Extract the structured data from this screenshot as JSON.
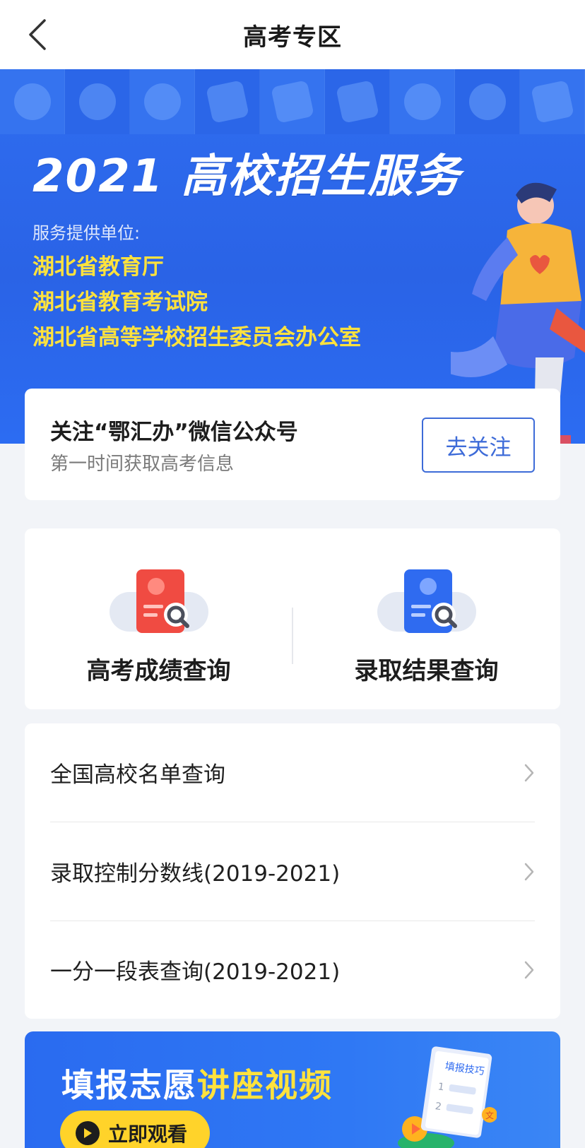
{
  "navbar": {
    "title": "高考专区",
    "back_icon": "chevron-left-icon"
  },
  "hero": {
    "title": "2021 高校招生服务",
    "provider_label": "服务提供单位:",
    "providers": [
      "湖北省教育厅",
      "湖北省教育考试院",
      "湖北省高等学校招生委员会办公室"
    ],
    "accent_color": "#ffe23d",
    "background_color": "#2c68ea"
  },
  "follow": {
    "title": "关注“鄂汇办”微信公众号",
    "subtitle": "第一时间获取高考信息",
    "button_label": "去关注",
    "button_color": "#3d6bd8"
  },
  "queries": [
    {
      "label": "高考成绩查询",
      "icon": "score-certificate-search-icon",
      "color": "#f04b42"
    },
    {
      "label": "录取结果查询",
      "icon": "admission-certificate-search-icon",
      "color": "#2f6bf0"
    }
  ],
  "list": [
    {
      "label": "全国高校名单查询",
      "icon": "chevron-right-icon"
    },
    {
      "label": "录取控制分数线(2019-2021)",
      "icon": "chevron-right-icon"
    },
    {
      "label": "一分一段表查询(2019-2021)",
      "icon": "chevron-right-icon"
    }
  ],
  "lecture": {
    "title_part1": "填报志愿",
    "title_part2": "讲座视频",
    "button_label": "立即观看",
    "book_label": "填报技巧",
    "book_items": [
      "1",
      "2"
    ],
    "badge": "文"
  }
}
